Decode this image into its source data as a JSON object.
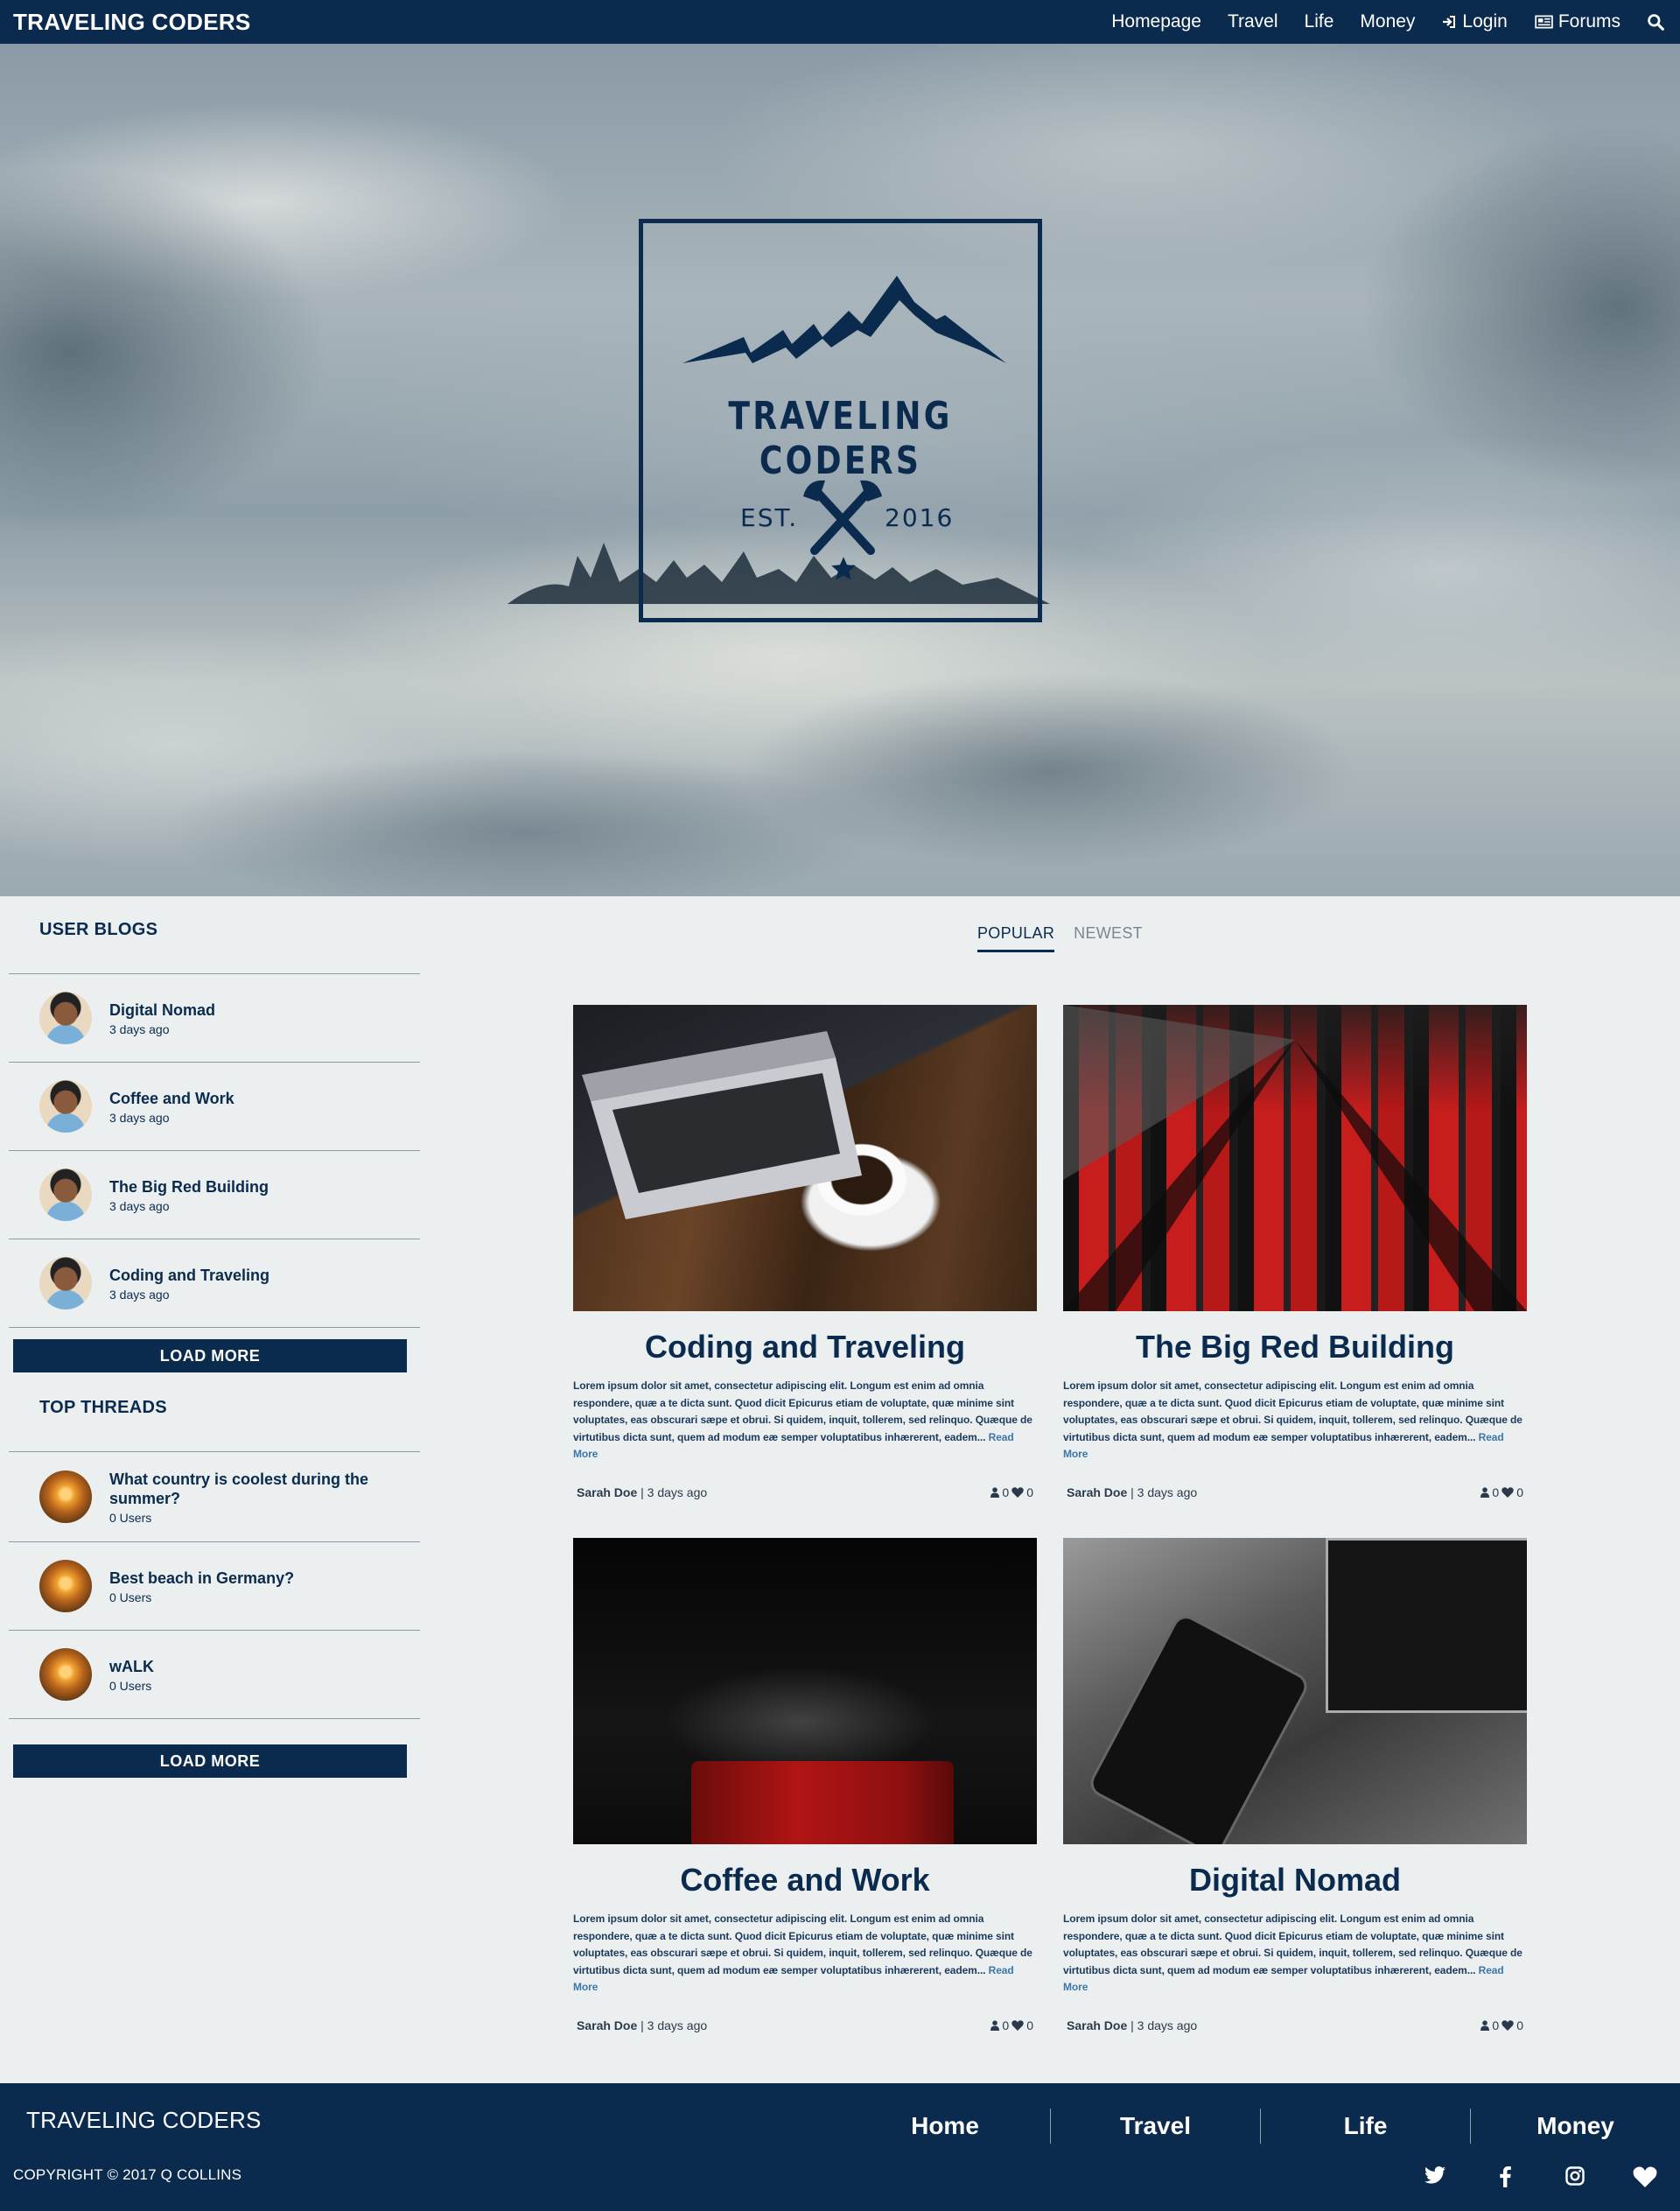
{
  "navbar": {
    "brand": "TRAVELING CODERS",
    "links": [
      {
        "label": "Homepage"
      },
      {
        "label": "Travel"
      },
      {
        "label": "Life"
      },
      {
        "label": "Money"
      },
      {
        "label": "Login",
        "icon": "sign-in-icon"
      },
      {
        "label": "Forums",
        "icon": "newspaper-icon"
      }
    ],
    "search_icon": "search-icon"
  },
  "hero": {
    "logo_title": "TRAVELING CODERS",
    "logo_est": "EST.",
    "logo_year": "2016"
  },
  "sidebar": {
    "user_blogs": {
      "heading": "USER BLOGS",
      "items": [
        {
          "title": "Digital Nomad",
          "subtitle": "3 days ago"
        },
        {
          "title": "Coffee and Work",
          "subtitle": "3 days ago"
        },
        {
          "title": "The Big Red Building",
          "subtitle": "3 days ago"
        },
        {
          "title": "Coding and Traveling",
          "subtitle": "3 days ago"
        }
      ],
      "load_more": "LOAD MORE"
    },
    "top_threads": {
      "heading": "TOP THREADS",
      "items": [
        {
          "title": "What country is coolest during the summer?",
          "subtitle": "0 Users"
        },
        {
          "title": "Best beach in Germany?",
          "subtitle": "0 Users"
        },
        {
          "title": "wALK",
          "subtitle": "0 Users"
        }
      ],
      "load_more": "LOAD MORE"
    }
  },
  "tabs": {
    "popular": "POPULAR",
    "newest": "NEWEST",
    "active": "POPULAR"
  },
  "posts": [
    {
      "title": "Coding and Traveling",
      "body": "Lorem ipsum dolor sit amet, consectetur adipiscing elit. Longum est enim ad omnia respondere, quæ a te dicta sunt. Quod dicit Epicurus etiam de voluptate, quæ minime sint voluptates, eas obscurari sæpe et obrui. Si quidem, inquit, tollerem, sed relinquo. Quæque de virtutibus dicta sunt, quem ad modum eæ semper voluptatibus inhærerent, eadem...",
      "read_more": "Read More",
      "author": "Sarah Doe",
      "date": "| 3 days ago",
      "users": "0",
      "likes": "0"
    },
    {
      "title": "The Big Red Building",
      "body": "Lorem ipsum dolor sit amet, consectetur adipiscing elit. Longum est enim ad omnia respondere, quæ a te dicta sunt. Quod dicit Epicurus etiam de voluptate, quæ minime sint voluptates, eas obscurari sæpe et obrui. Si quidem, inquit, tollerem, sed relinquo. Quæque de virtutibus dicta sunt, quem ad modum eæ semper voluptatibus inhærerent, eadem...",
      "read_more": "Read More",
      "author": "Sarah Doe",
      "date": "| 3 days ago",
      "users": "0",
      "likes": "0"
    },
    {
      "title": "Coffee and Work",
      "body": "Lorem ipsum dolor sit amet, consectetur adipiscing elit. Longum est enim ad omnia respondere, quæ a te dicta sunt. Quod dicit Epicurus etiam de voluptate, quæ minime sint voluptates, eas obscurari sæpe et obrui. Si quidem, inquit, tollerem, sed relinquo. Quæque de virtutibus dicta sunt, quem ad modum eæ semper voluptatibus inhærerent, eadem...",
      "read_more": "Read More",
      "author": "Sarah Doe",
      "date": "| 3 days ago",
      "users": "0",
      "likes": "0"
    },
    {
      "title": "Digital Nomad",
      "body": "Lorem ipsum dolor sit amet, consectetur adipiscing elit. Longum est enim ad omnia respondere, quæ a te dicta sunt. Quod dicit Epicurus etiam de voluptate, quæ minime sint voluptates, eas obscurari sæpe et obrui. Si quidem, inquit, tollerem, sed relinquo. Quæque de virtutibus dicta sunt, quem ad modum eæ semper voluptatibus inhærerent, eadem...",
      "read_more": "Read More",
      "author": "Sarah Doe",
      "date": "| 3 days ago",
      "users": "0",
      "likes": "0"
    }
  ],
  "footer": {
    "brand": "TRAVELING CODERS",
    "copyright": "COPYRIGHT © 2017 Q COLLINS",
    "links": [
      {
        "label": "Home"
      },
      {
        "label": "Travel"
      },
      {
        "label": "Life"
      },
      {
        "label": "Money"
      }
    ],
    "social_icons": [
      "twitter-icon",
      "facebook-icon",
      "instagram-icon",
      "heart-icon"
    ]
  },
  "colors": {
    "primary": "#0a2b4e",
    "background": "#eceff0",
    "link": "#3b76a8"
  }
}
